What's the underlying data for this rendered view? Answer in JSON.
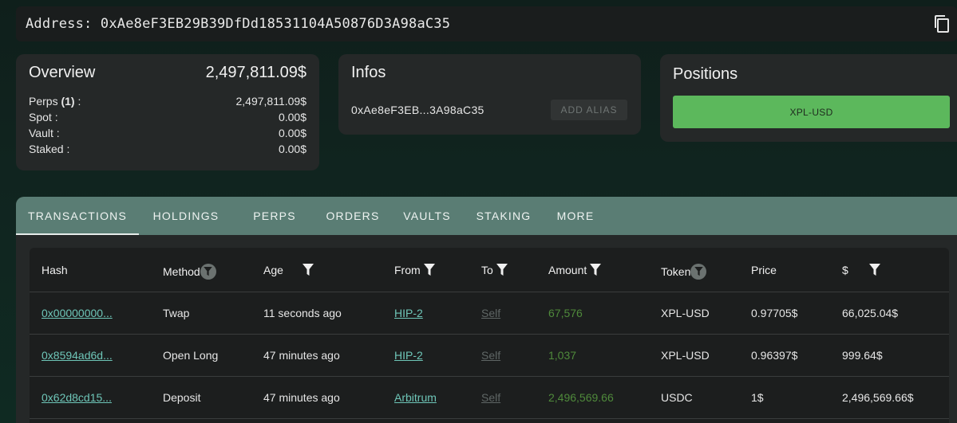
{
  "address_bar": {
    "text": "Address: 0xAe8eF3EB29B39DfDd18531104A50876D3A98aC35",
    "copy_icon": "copy-icon"
  },
  "overview": {
    "title": "Overview",
    "total": "2,497,811.09$",
    "rows": [
      {
        "label_prefix": "Perps ",
        "label_bold": "(1)",
        "label_suffix": " :",
        "value": "2,497,811.09$"
      },
      {
        "label_prefix": "Spot :",
        "label_bold": "",
        "label_suffix": "",
        "value": "0.00$"
      },
      {
        "label_prefix": "Vault :",
        "label_bold": "",
        "label_suffix": "",
        "value": "0.00$"
      },
      {
        "label_prefix": "Staked :",
        "label_bold": "",
        "label_suffix": "",
        "value": "0.00$"
      }
    ]
  },
  "infos": {
    "title": "Infos",
    "short_address": "0xAe8eF3EB...3A98aC35",
    "add_alias_label": "ADD ALIAS"
  },
  "positions": {
    "title": "Positions",
    "items": [
      "XPL-USD"
    ],
    "chip_color": "#5cb85c"
  },
  "tabs": {
    "items": [
      "TRANSACTIONS",
      "HOLDINGS",
      "PERPS",
      "ORDERS",
      "VAULTS",
      "STAKING",
      "MORE"
    ],
    "active": "TRANSACTIONS"
  },
  "table": {
    "columns": [
      "Hash",
      "Method",
      "Age",
      "From",
      "To",
      "Amount",
      "Token",
      "Price",
      "$"
    ],
    "rows": [
      {
        "hash": "0x00000000...",
        "method": "Twap",
        "age": "11 seconds ago",
        "from": "HIP-2",
        "to": "Self",
        "amount": "67,576",
        "token": "XPL-USD",
        "price": "0.97705$",
        "usd": "66,025.04$"
      },
      {
        "hash": "0x8594ad6d...",
        "method": "Open Long",
        "age": "47 minutes ago",
        "from": "HIP-2",
        "to": "Self",
        "amount": "1,037",
        "token": "XPL-USD",
        "price": "0.96397$",
        "usd": "999.64$"
      },
      {
        "hash": "0x62d8cd15...",
        "method": "Deposit",
        "age": "47 minutes ago",
        "from": "Arbitrum",
        "to": "Self",
        "amount": "2,496,569.66",
        "token": "USDC",
        "price": "1$",
        "usd": "2,496,569.66$"
      }
    ]
  },
  "colors": {
    "link": "#6ec6b8",
    "amount_green": "#4f8a3b",
    "tabbar": "#5a7d74"
  }
}
